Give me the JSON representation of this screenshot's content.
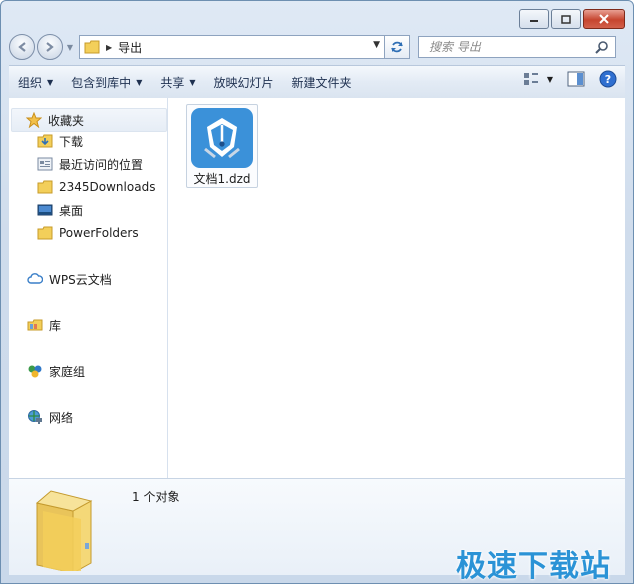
{
  "address": {
    "path": "导出",
    "search_placeholder": "搜索 导出"
  },
  "toolbar": {
    "items": [
      "组织",
      "包含到库中",
      "共享",
      "放映幻灯片",
      "新建文件夹"
    ]
  },
  "nav": {
    "favorites_label": "收藏夹",
    "favorites": [
      "下载",
      "最近访问的位置",
      "2345Downloads",
      "桌面",
      "PowerFolders"
    ],
    "wps_cloud": "WPS云文档",
    "library": "库",
    "homegroup": "家庭组",
    "network": "网络"
  },
  "files": [
    {
      "name": "文档1.dzd",
      "icon": "pen-nib-icon"
    }
  ],
  "status": {
    "count_text": "1 个对象"
  },
  "watermark": "极速下载站",
  "colors": {
    "accent": "#3b91d9",
    "folder": "#f3cf5a",
    "close": "#c6452f"
  }
}
